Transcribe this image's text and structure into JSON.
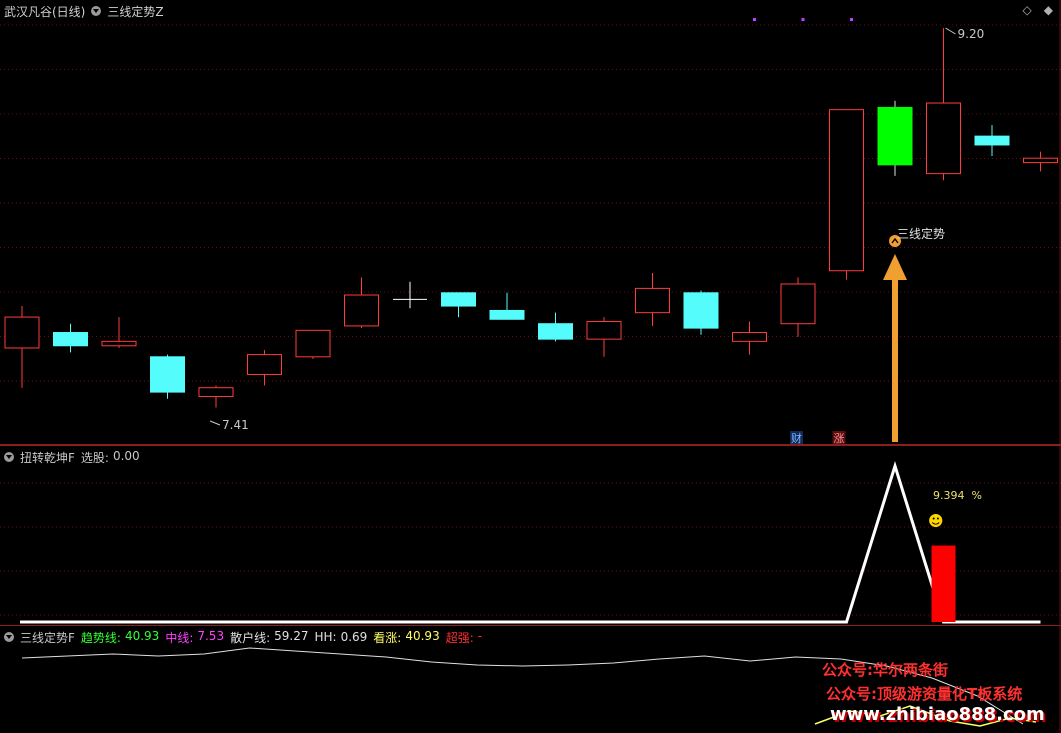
{
  "main": {
    "stock_title": "武汉凡谷(日线)",
    "indicator_name": "三线定势Z",
    "high_label": "9.20",
    "low_label": "7.41",
    "signal_label": "三线定势",
    "badge_cai": "财",
    "badge_zhang": "涨",
    "corner_icons": [
      "diamond-icon",
      "diamond-filled-icon"
    ],
    "colors": {
      "up": "#ff3b3b",
      "down": "#54fcfc",
      "signal": "#00ff00",
      "arrow": "#f0a030",
      "dot": "#c040ff"
    },
    "candles": [
      {
        "o": 7.75,
        "h": 7.94,
        "l": 7.57,
        "c": 7.89,
        "type": "up"
      },
      {
        "o": 7.82,
        "h": 7.86,
        "l": 7.73,
        "c": 7.76,
        "type": "down"
      },
      {
        "o": 7.76,
        "h": 7.89,
        "l": 7.75,
        "c": 7.78,
        "type": "up"
      },
      {
        "o": 7.71,
        "h": 7.72,
        "l": 7.52,
        "c": 7.55,
        "type": "down"
      },
      {
        "o": 7.53,
        "h": 7.58,
        "l": 7.48,
        "c": 7.57,
        "type": "up"
      },
      {
        "o": 7.63,
        "h": 7.74,
        "l": 7.58,
        "c": 7.72,
        "type": "up"
      },
      {
        "o": 7.71,
        "h": 7.83,
        "l": 7.7,
        "c": 7.83,
        "type": "up"
      },
      {
        "o": 7.85,
        "h": 8.07,
        "l": 7.84,
        "c": 7.99,
        "type": "up"
      },
      {
        "o": 7.97,
        "h": 8.05,
        "l": 7.93,
        "c": 7.97,
        "type": "cross"
      },
      {
        "o": 8.0,
        "h": 8.0,
        "l": 7.89,
        "c": 7.94,
        "type": "down"
      },
      {
        "o": 7.92,
        "h": 8.0,
        "l": 7.88,
        "c": 7.88,
        "type": "down"
      },
      {
        "o": 7.86,
        "h": 7.91,
        "l": 7.78,
        "c": 7.79,
        "type": "down"
      },
      {
        "o": 7.79,
        "h": 7.89,
        "l": 7.71,
        "c": 7.87,
        "type": "up"
      },
      {
        "o": 7.91,
        "h": 8.09,
        "l": 7.85,
        "c": 8.02,
        "type": "up"
      },
      {
        "o": 8.0,
        "h": 8.01,
        "l": 7.81,
        "c": 7.84,
        "type": "down"
      },
      {
        "o": 7.82,
        "h": 7.87,
        "l": 7.72,
        "c": 7.78,
        "type": "up"
      },
      {
        "o": 7.86,
        "h": 8.07,
        "l": 7.8,
        "c": 8.04,
        "type": "up"
      },
      {
        "o": 8.1,
        "h": 8.83,
        "l": 8.06,
        "c": 8.83,
        "type": "up"
      },
      {
        "o": 8.84,
        "h": 8.87,
        "l": 8.53,
        "c": 8.58,
        "type": "signal"
      },
      {
        "o": 8.54,
        "h": 9.2,
        "l": 8.51,
        "c": 8.86,
        "type": "up"
      },
      {
        "o": 8.71,
        "h": 8.76,
        "l": 8.62,
        "c": 8.67,
        "type": "down"
      },
      {
        "o": 8.59,
        "h": 8.64,
        "l": 8.55,
        "c": 8.61,
        "type": "up"
      }
    ]
  },
  "sub1": {
    "indicator_name": "扭转乾坤F",
    "select_label": "选股:",
    "select_value": "0.00",
    "pct_label": "9.394  %",
    "smiley": "☻",
    "colors": {
      "line": "#ffffff",
      "bar": "#ff0000"
    },
    "line_values": [
      0,
      0,
      0,
      0,
      0,
      0,
      0,
      0,
      0,
      0,
      0,
      0,
      0,
      0,
      0,
      0,
      0,
      0,
      100,
      0,
      0,
      0
    ],
    "bar_value": 49
  },
  "sub2": {
    "indicator_name": "三线定势F",
    "trend_label": "趋势线:",
    "trend_value": "40.93",
    "mid_label": "中线:",
    "mid_value": "7.53",
    "retail_label": "散户线:",
    "retail_value": "59.27",
    "hh_label": "HH:",
    "hh_value": "0.69",
    "kanzhang_label": "看涨:",
    "kanzhang_value": "40.93",
    "chaoqiang_label": "超强:",
    "chaoqiang_value": "-",
    "colors": {
      "trend": "#33ff33",
      "mid": "#ff40ff",
      "retail": "#e0e0e0",
      "hh": "#e0e0e0",
      "kanzhang": "#ffff66",
      "chaoqiang": "#ff3030"
    }
  },
  "watermark": {
    "line1": "公众号:华尔两条街",
    "line2": "公众号:顶级游资量化T板系统",
    "line3": "www.zhibiao888.com"
  }
}
